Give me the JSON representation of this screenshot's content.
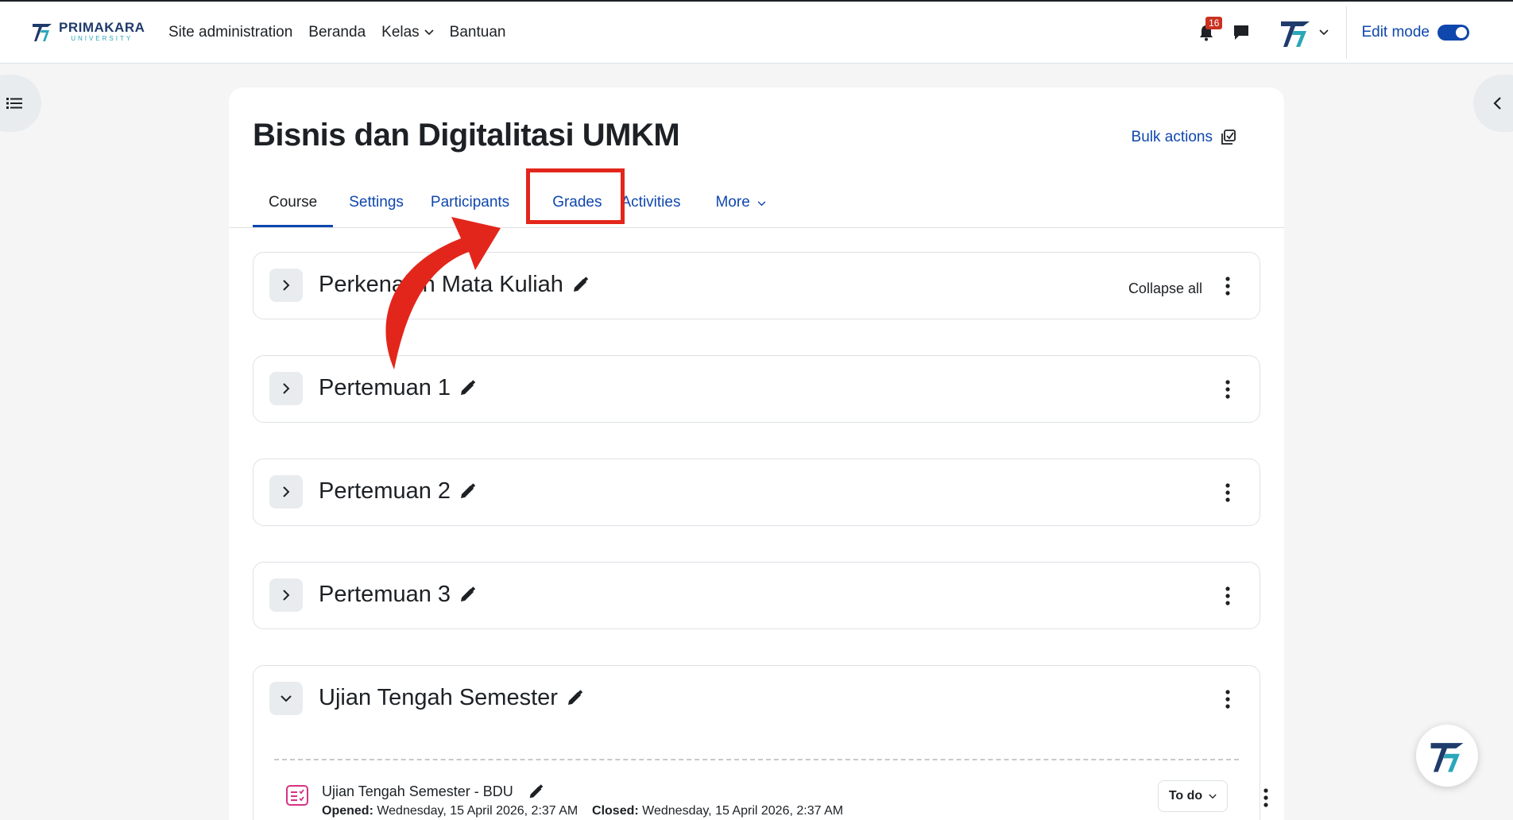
{
  "brand": {
    "name": "PRIMAKARA",
    "sub": "UNIVERSITY"
  },
  "nav": {
    "site_admin": "Site administration",
    "home": "Beranda",
    "classes": "Kelas",
    "help": "Bantuan"
  },
  "header": {
    "notification_count": "16",
    "edit_mode_label": "Edit mode"
  },
  "course": {
    "title": "Bisnis dan Digitalitasi UMKM",
    "bulk_actions": "Bulk actions",
    "tabs": {
      "course": "Course",
      "settings": "Settings",
      "participants": "Participants",
      "grades": "Grades",
      "activities": "Activities",
      "more": "More"
    },
    "collapse_all": "Collapse all",
    "sections": [
      {
        "title": "Perkenalan Mata Kuliah"
      },
      {
        "title": "Pertemuan 1"
      },
      {
        "title": "Pertemuan 2"
      },
      {
        "title": "Pertemuan 3"
      },
      {
        "title": "Ujian Tengah Semester"
      }
    ],
    "activity": {
      "name": "Ujian Tengah Semester - BDU",
      "opened_label": "Opened:",
      "opened_value": "Wednesday, 15 April 2026, 2:37 AM",
      "closed_label": "Closed:",
      "closed_value": "Wednesday, 15 April 2026, 2:37 AM",
      "todo_label": "To do"
    }
  },
  "colors": {
    "accent": "#0f47ad",
    "highlight": "#e3261b",
    "badge": "#ca3120"
  }
}
